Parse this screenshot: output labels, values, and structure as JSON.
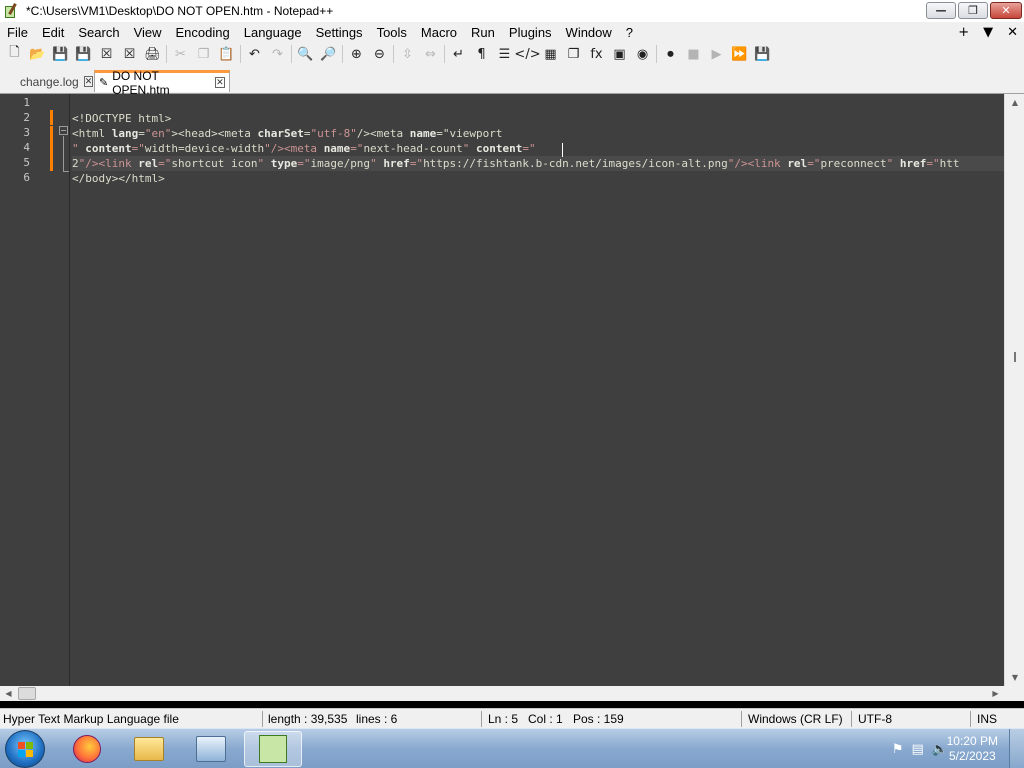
{
  "window": {
    "title": "*C:\\Users\\VM1\\Desktop\\DO NOT OPEN.htm - Notepad++",
    "minimize_glyph": "—",
    "maximize_glyph": "❐",
    "close_glyph": "✕"
  },
  "menu": {
    "items": [
      "File",
      "Edit",
      "Search",
      "View",
      "Encoding",
      "Language",
      "Settings",
      "Tools",
      "Macro",
      "Run",
      "Plugins",
      "Window",
      "?"
    ],
    "right": {
      "add": "+",
      "dropdown": "▼",
      "close": "✕"
    }
  },
  "toolbar": {
    "icons": [
      {
        "name": "new-file-icon",
        "glyph": "🗋"
      },
      {
        "name": "open-file-icon",
        "glyph": "📂"
      },
      {
        "name": "save-icon",
        "glyph": "💾"
      },
      {
        "name": "save-all-icon",
        "glyph": "💾"
      },
      {
        "name": "close-icon",
        "glyph": "☒"
      },
      {
        "name": "close-all-icon",
        "glyph": "☒"
      },
      {
        "name": "print-icon",
        "glyph": "🖨"
      },
      {
        "name": "cut-icon",
        "glyph": "✂"
      },
      {
        "name": "copy-icon",
        "glyph": "❐"
      },
      {
        "name": "paste-icon",
        "glyph": "📋"
      },
      {
        "name": "undo-icon",
        "glyph": "↶"
      },
      {
        "name": "redo-icon",
        "glyph": "↷"
      },
      {
        "name": "find-icon",
        "glyph": "🔍"
      },
      {
        "name": "replace-icon",
        "glyph": "🔎"
      },
      {
        "name": "zoom-in-icon",
        "glyph": "⊕"
      },
      {
        "name": "zoom-out-icon",
        "glyph": "⊖"
      },
      {
        "name": "sync-vertical-icon",
        "glyph": "⇳"
      },
      {
        "name": "sync-horizontal-icon",
        "glyph": "⇔"
      },
      {
        "name": "word-wrap-icon",
        "glyph": "↵"
      },
      {
        "name": "show-all-chars-icon",
        "glyph": "¶"
      },
      {
        "name": "indent-guide-icon",
        "glyph": "☰"
      },
      {
        "name": "language-tag-icon",
        "glyph": "</>"
      },
      {
        "name": "doc-map-icon",
        "glyph": "▦"
      },
      {
        "name": "doc-list-icon",
        "glyph": "❐"
      },
      {
        "name": "function-list-icon",
        "glyph": "fx"
      },
      {
        "name": "folder-workspace-icon",
        "glyph": "▣"
      },
      {
        "name": "monitoring-icon",
        "glyph": "◉"
      },
      {
        "name": "record-macro-icon",
        "glyph": "⏺"
      },
      {
        "name": "stop-record-icon",
        "glyph": "■"
      },
      {
        "name": "play-macro-icon",
        "glyph": "▶"
      },
      {
        "name": "run-macro-multiple-icon",
        "glyph": "⏩"
      },
      {
        "name": "save-macro-icon",
        "glyph": "💾"
      }
    ],
    "dimmed": [
      "cut-icon",
      "copy-icon",
      "redo-icon",
      "sync-vertical-icon",
      "sync-horizontal-icon",
      "stop-record-icon",
      "play-macro-icon",
      "save-macro-icon"
    ]
  },
  "tabs": [
    {
      "label": "change.log",
      "close": "✕",
      "active": false
    },
    {
      "label": "DO NOT OPEN.htm",
      "close": "✕",
      "active": true,
      "modified_icon": "✎"
    }
  ],
  "editor": {
    "line_numbers": [
      "1",
      "2",
      "3",
      "4",
      "5",
      "6"
    ],
    "fold_glyph": "−",
    "lines": [
      "",
      "<!DOCTYPE html>",
      "<html lang=\"en\"><head><meta charSet=\"utf-8\"/><meta name=\"viewport",
      "\" content=\"width=device-width\"/><meta name=\"next-head-count\" content=\"",
      "2\"/><link rel=\"shortcut icon\" type=\"image/png\" href=\"https://fishtank.b-cdn.net/images/icon-alt.png\"/><link rel=\"preconnect\" href=\"htt",
      "</body></html>"
    ]
  },
  "statusbar": {
    "file_type": "Hyper Text Markup Language file",
    "length": "length : 39,535",
    "lines": "lines : 6",
    "ln": "Ln : 5",
    "col": "Col : 1",
    "pos": "Pos : 159",
    "eol": "Windows (CR LF)",
    "encoding": "UTF-8",
    "mode": "INS"
  },
  "taskbar": {
    "time": "10:20 PM",
    "date": "5/2/2023"
  },
  "colors": {
    "editor_bg": "#3f3f3f",
    "tab_accent": "#fa9a3c",
    "change_marker": "#fd8000"
  }
}
